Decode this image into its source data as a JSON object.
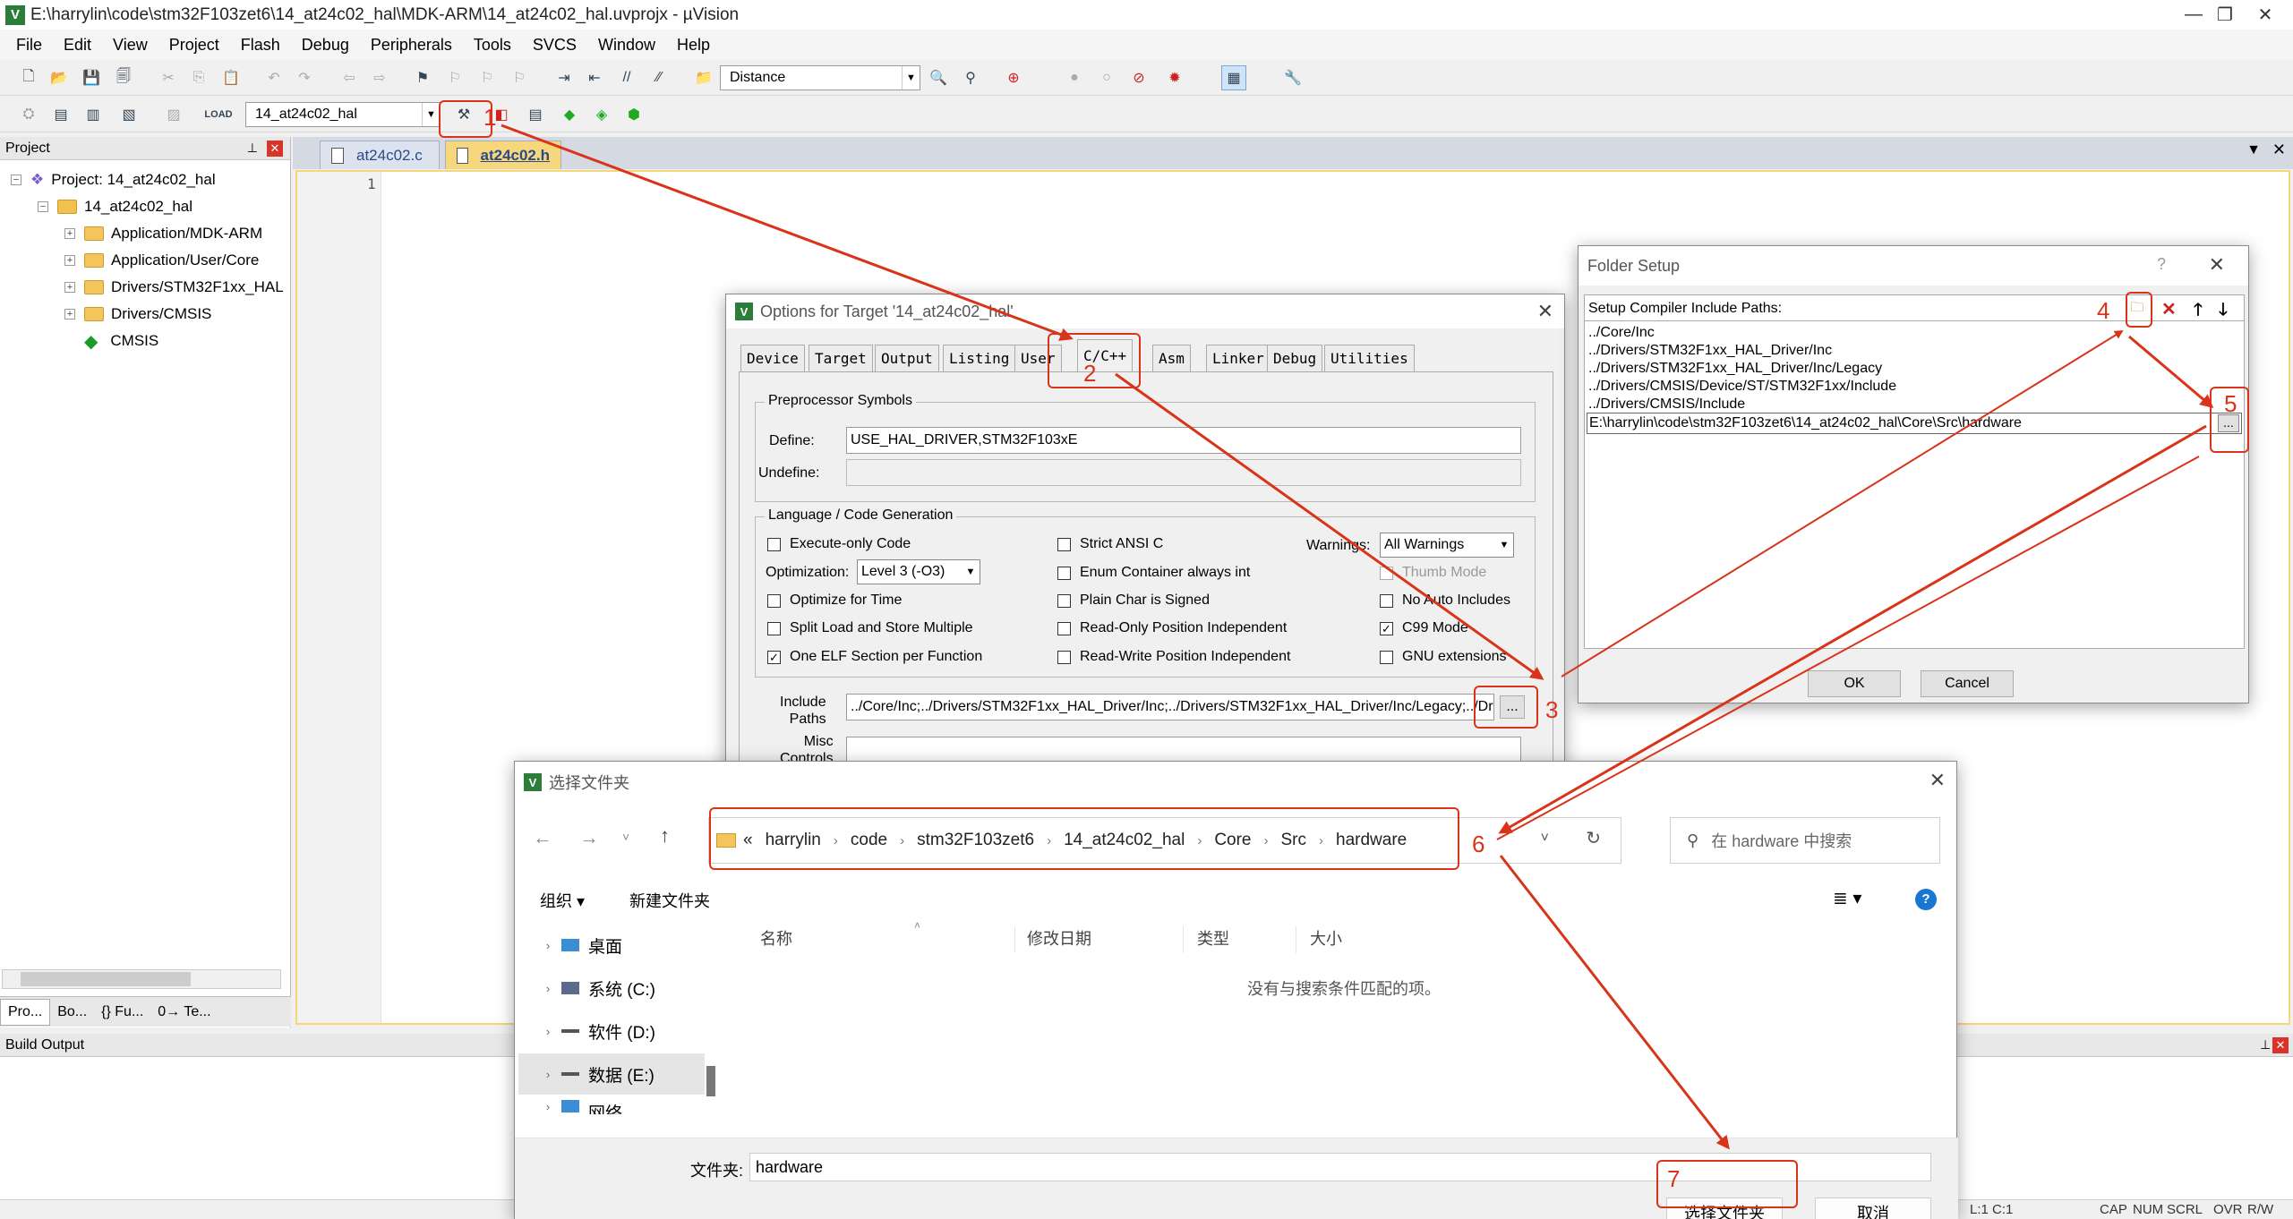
{
  "window": {
    "title": "E:\\harrylin\\code\\stm32F103zet6\\14_at24c02_hal\\MDK-ARM\\14_at24c02_hal.uvprojx - µVision",
    "app_icon": "V",
    "minimize": "—",
    "restore": "❐",
    "close": "✕"
  },
  "menu": [
    "File",
    "Edit",
    "View",
    "Project",
    "Flash",
    "Debug",
    "Peripherals",
    "Tools",
    "SVCS",
    "Window",
    "Help"
  ],
  "toolbar1": {
    "search_combo": "Distance"
  },
  "toolbar2": {
    "target_combo": "14_at24c02_hal"
  },
  "project_panel": {
    "title": "Project",
    "tree": [
      {
        "label": "Project: 14_at24c02_hal",
        "level": 0
      },
      {
        "label": "14_at24c02_hal",
        "level": 1
      },
      {
        "label": "Application/MDK-ARM",
        "level": 2
      },
      {
        "label": "Application/User/Core",
        "level": 2
      },
      {
        "label": "Drivers/STM32F1xx_HAL",
        "level": 2
      },
      {
        "label": "Drivers/CMSIS",
        "level": 2
      },
      {
        "label": "CMSIS",
        "level": 2
      }
    ],
    "bottom_tabs": [
      "Pro...",
      "Bo...",
      "{} Fu...",
      "0→ Te..."
    ]
  },
  "editor": {
    "tabs": [
      "at24c02.c",
      "at24c02.h"
    ],
    "active_tab": "at24c02.h",
    "line_number": "1"
  },
  "build_output": {
    "title": "Build Output"
  },
  "options_dialog": {
    "title": "Options for Target '14_at24c02_hal'",
    "tabs": [
      "Device",
      "Target",
      "Output",
      "Listing",
      "User",
      "C/C++",
      "Asm",
      "Linker",
      "Debug",
      "Utilities"
    ],
    "preprocessor": {
      "legend": "Preprocessor Symbols",
      "define_label": "Define:",
      "define_value": "USE_HAL_DRIVER,STM32F103xE",
      "undefine_label": "Undefine:"
    },
    "language": {
      "legend": "Language / Code Generation",
      "execute_only": "Execute-only Code",
      "optimization_label": "Optimization:",
      "optimization_value": "Level 3 (-O3)",
      "optimize_time": "Optimize for Time",
      "split_load": "Split Load and Store Multiple",
      "one_elf": "One ELF Section per Function",
      "strict_ansi": "Strict ANSI C",
      "enum_container": "Enum Container always int",
      "plain_char": "Plain Char is Signed",
      "ro_pos": "Read-Only Position Independent",
      "rw_pos": "Read-Write Position Independent",
      "warnings_label": "Warnings:",
      "warnings_value": "All Warnings",
      "thumb_mode": "Thumb Mode",
      "no_auto": "No Auto Includes",
      "c99": "C99 Mode",
      "gnu_ext": "GNU extensions"
    },
    "include_label": "Include\nPaths",
    "include_value": "../Core/Inc;../Drivers/STM32F1xx_HAL_Driver/Inc;../Drivers/STM32F1xx_HAL_Driver/Inc/Legacy;../Driv",
    "misc_label": "Misc\nControls",
    "browse": "..."
  },
  "folder_dialog": {
    "title": "Folder Setup",
    "help": "?",
    "header": "Setup Compiler Include Paths:",
    "paths": [
      "../Core/Inc",
      "../Drivers/STM32F1xx_HAL_Driver/Inc",
      "../Drivers/STM32F1xx_HAL_Driver/Inc/Legacy",
      "../Drivers/CMSIS/Device/ST/STM32F1xx/Include",
      "../Drivers/CMSIS/Include"
    ],
    "editing_path": "E:\\harrylin\\code\\stm32F103zet6\\14_at24c02_hal\\Core\\Src\\hardware",
    "browse": "...",
    "ok": "OK",
    "cancel": "Cancel"
  },
  "file_dialog": {
    "title": "选择文件夹",
    "breadcrumb": [
      "«",
      "harrylin",
      "code",
      "stm32F103zet6",
      "14_at24c02_hal",
      "Core",
      "Src",
      "hardware"
    ],
    "search_placeholder": "在 hardware 中搜索",
    "organize": "组织 ▾",
    "new_folder": "新建文件夹",
    "columns": [
      "名称",
      "修改日期",
      "类型",
      "大小"
    ],
    "empty_message": "没有与搜索条件匹配的项。",
    "nav": [
      "桌面",
      "系统 (C:)",
      "软件 (D:)",
      "数据 (E:)",
      "网络"
    ],
    "folder_label": "文件夹:",
    "folder_value": "hardware",
    "select_button": "选择文件夹",
    "cancel_button": "取消"
  },
  "annotations": [
    "1",
    "2",
    "3",
    "4",
    "5",
    "6",
    "7"
  ],
  "statusbar": {
    "pos": "L:1 C:1",
    "flags": [
      "CAP",
      "NUM",
      "SCRL",
      "OVR",
      "R/W"
    ]
  },
  "colors": {
    "annotation": "#d9341a",
    "editor_border": "#f5d67a",
    "accent": "#0067c0"
  }
}
